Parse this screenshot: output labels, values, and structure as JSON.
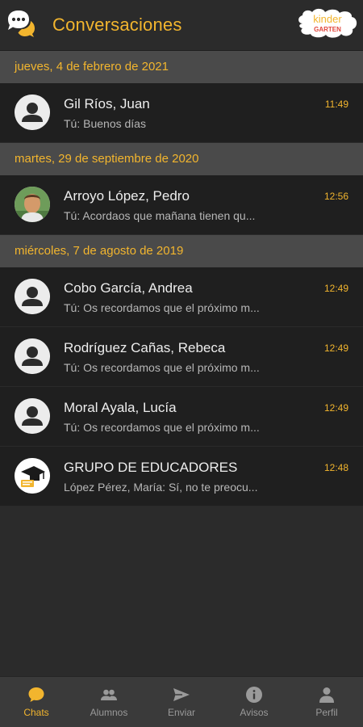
{
  "header": {
    "title": "Conversaciones",
    "brand_top": "kinder",
    "brand_bottom": "GARTEN"
  },
  "groups": [
    {
      "date": "jueves, 4 de febrero de 2021",
      "chats": [
        {
          "name": "Gil Ríos, Juan",
          "preview": "Tú: Buenos días",
          "time": "11:49",
          "avatar": "person-placeholder"
        }
      ]
    },
    {
      "date": "martes, 29 de septiembre de 2020",
      "chats": [
        {
          "name": "Arroyo López, Pedro",
          "preview": "Tú: Acordaos que mañana tienen qu...",
          "time": "12:56",
          "avatar": "photo"
        }
      ]
    },
    {
      "date": "miércoles, 7 de agosto de 2019",
      "chats": [
        {
          "name": "Cobo García, Andrea",
          "preview": "Tú: Os recordamos que el próximo m...",
          "time": "12:49",
          "avatar": "person-placeholder"
        },
        {
          "name": "Rodríguez Cañas, Rebeca",
          "preview": "Tú: Os recordamos que el próximo m...",
          "time": "12:49",
          "avatar": "person-placeholder"
        },
        {
          "name": "Moral Ayala, Lucía",
          "preview": "Tú: Os recordamos que el próximo m...",
          "time": "12:49",
          "avatar": "person-placeholder"
        },
        {
          "name": "GRUPO DE EDUCADORES",
          "preview": "López Pérez, María: Sí, no te preocu...",
          "time": "12:48",
          "avatar": "graduation-icon"
        }
      ]
    }
  ],
  "bottom_nav": [
    {
      "label": "Chats",
      "icon": "chat-bubble-icon",
      "active": true
    },
    {
      "label": "Alumnos",
      "icon": "people-icon",
      "active": false
    },
    {
      "label": "Enviar",
      "icon": "send-icon",
      "active": false
    },
    {
      "label": "Avisos",
      "icon": "info-icon",
      "active": false
    },
    {
      "label": "Perfil",
      "icon": "profile-icon",
      "active": false
    }
  ],
  "colors": {
    "accent": "#f2b52e",
    "background": "#2b2b2b",
    "row": "#1f1f1f",
    "separator": "#4a4a4a"
  }
}
